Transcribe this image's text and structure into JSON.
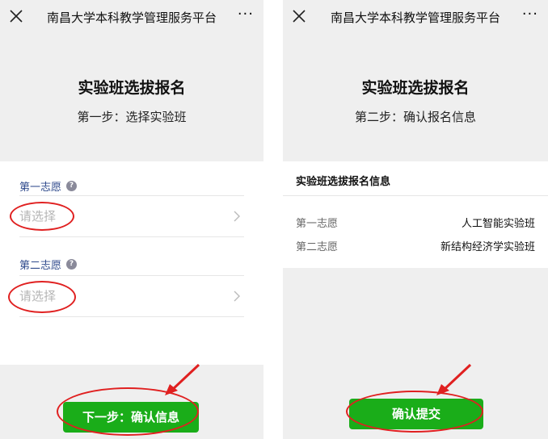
{
  "left": {
    "nav": {
      "title": "南昌大学本科教学管理服务平台",
      "more": "···"
    },
    "heading": "实验班选拔报名",
    "step": "第一步：选择实验班",
    "fields": [
      {
        "label": "第一志愿",
        "help": "?",
        "placeholder": "请选择"
      },
      {
        "label": "第二志愿",
        "help": "?",
        "placeholder": "请选择"
      }
    ],
    "next_button": "下一步：确认信息"
  },
  "right": {
    "nav": {
      "title": "南昌大学本科教学管理服务平台",
      "more": "···"
    },
    "heading": "实验班选拔报名",
    "step": "第二步：确认报名信息",
    "info_title": "实验班选拔报名信息",
    "rows": [
      {
        "key": "第一志愿",
        "value": "人工智能实验班"
      },
      {
        "key": "第二志愿",
        "value": "新结构经济学实验班"
      }
    ],
    "submit_button": "确认提交"
  },
  "colors": {
    "accent_green": "#1aad19",
    "annotation_red": "#e02020",
    "label_blue": "#2f4a8c"
  }
}
